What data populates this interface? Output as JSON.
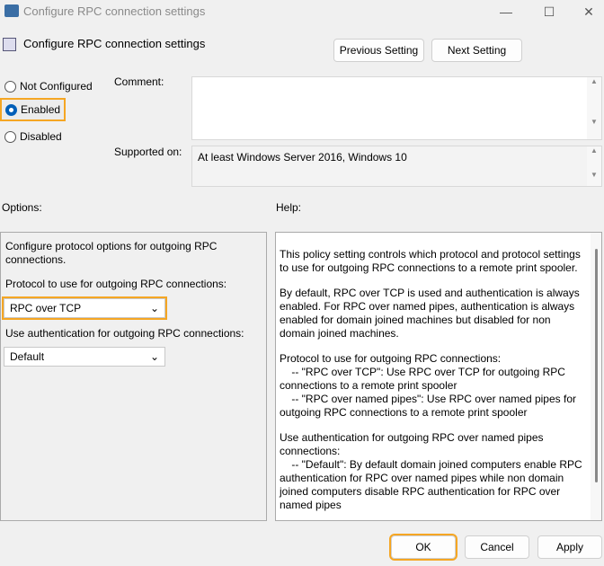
{
  "window": {
    "title": "Configure RPC connection settings"
  },
  "header": {
    "title": "Configure RPC connection settings",
    "prev": "Previous Setting",
    "next": "Next Setting"
  },
  "state": {
    "options": [
      "Not Configured",
      "Enabled",
      "Disabled"
    ],
    "selected": "Enabled"
  },
  "comment": {
    "label": "Comment:",
    "value": ""
  },
  "supported": {
    "label": "Supported on:",
    "value": "At least Windows Server 2016, Windows 10"
  },
  "options": {
    "label": "Options:",
    "desc": "Configure protocol options for outgoing RPC connections.",
    "protocol_label": "Protocol to use for outgoing RPC connections:",
    "protocol_value": "RPC over TCP",
    "auth_label": "Use authentication for outgoing RPC connections:",
    "auth_value": "Default"
  },
  "help": {
    "label": "Help:",
    "paragraphs": [
      "This policy setting controls which protocol and protocol settings to use for outgoing RPC connections to a remote print spooler.",
      "By default, RPC over TCP is used and authentication is always enabled. For RPC over named pipes, authentication is always enabled for domain joined machines but disabled for non domain joined machines.",
      "Protocol to use for outgoing RPC connections:\n    -- \"RPC over TCP\": Use RPC over TCP for outgoing RPC connections to a remote print spooler\n    -- \"RPC over named pipes\": Use RPC over named pipes for outgoing RPC connections to a remote print spooler",
      "Use authentication for outgoing RPC over named pipes connections:\n    -- \"Default\": By default domain joined computers enable RPC authentication for RPC over named pipes while non domain joined computers disable RPC authentication for RPC over named pipes"
    ]
  },
  "footer": {
    "ok": "OK",
    "cancel": "Cancel",
    "apply": "Apply"
  },
  "colors": {
    "accent": "#005fb8",
    "highlight": "#f5a623"
  }
}
